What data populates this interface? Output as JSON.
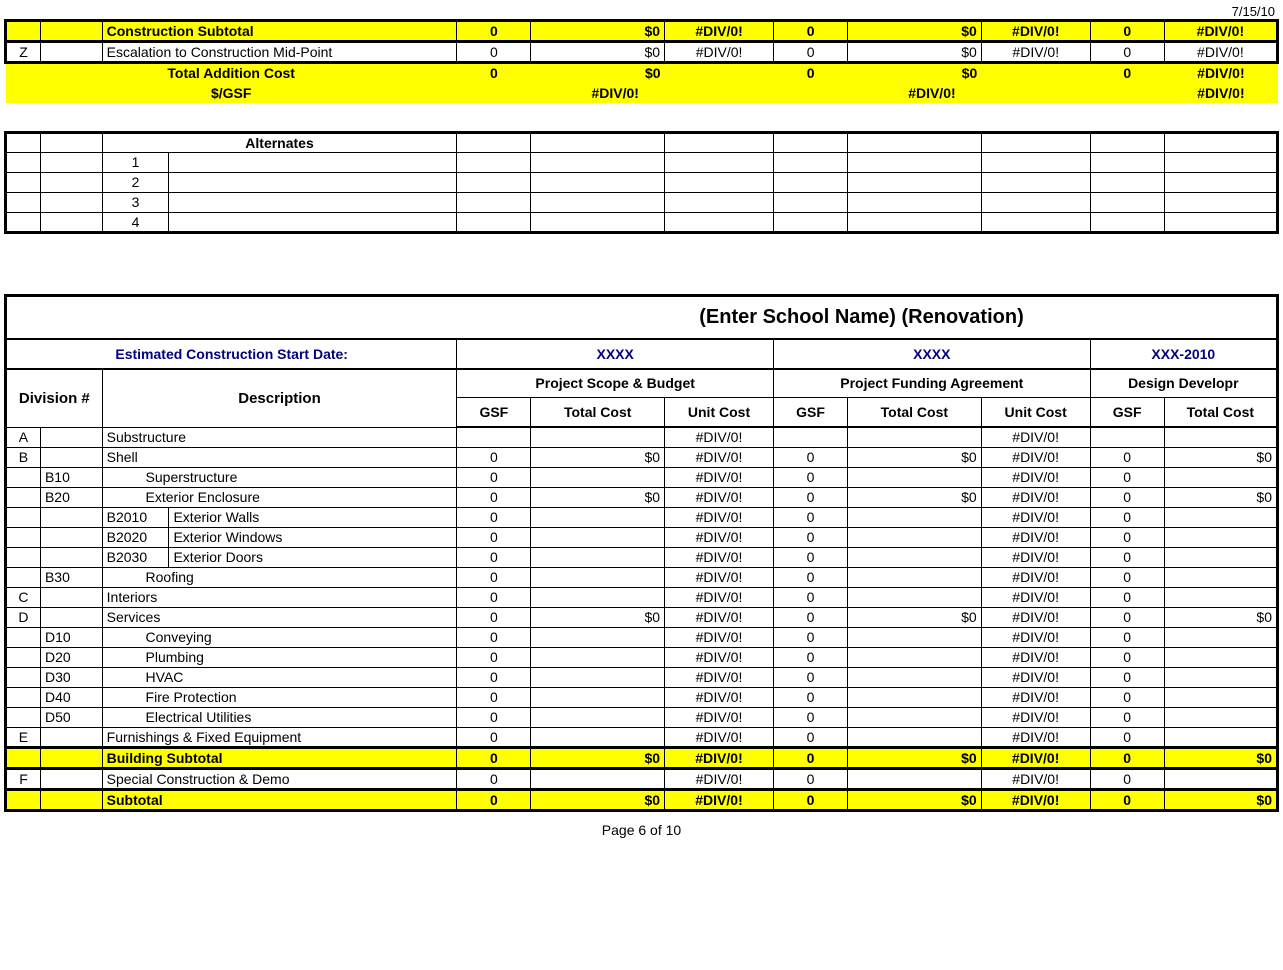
{
  "header_date": "7/15/10",
  "top": {
    "construction_subtotal": "Construction Subtotal",
    "escalation_row_label": "Escalation to Construction Mid-Point",
    "escalation_code": "Z",
    "total_addition_cost": "Total Addition Cost",
    "per_gsf": "$/GSF",
    "vals": {
      "zero": "0",
      "dollar0": "$0",
      "div0": "#DIV/0!"
    }
  },
  "alternates": {
    "header": "Alternates",
    "rows": [
      "1",
      "2",
      "3",
      "4"
    ]
  },
  "section2": {
    "title": "(Enter School Name) (Renovation)",
    "est_start": "Estimated Construction Start Date:",
    "xxxx": "XXXX",
    "xxx2010": "XXX-2010",
    "psb": "Project Scope & Budget",
    "pfa": "Project Funding Agreement",
    "dd": "Design Developr",
    "division": "Division #",
    "description": "Description",
    "gsf": "GSF",
    "total_cost": "Total Cost",
    "unit_cost": "Unit Cost"
  },
  "rows": [
    {
      "a": "A",
      "b": "",
      "c": "",
      "desc": "Substructure",
      "gsf1": "",
      "tc1": "",
      "uc1": "#DIV/0!",
      "gsf2": "",
      "tc2": "",
      "uc2": "#DIV/0!",
      "gsf3": "",
      "tc3": ""
    },
    {
      "a": "B",
      "b": "",
      "c": "",
      "desc": "Shell",
      "gsf1": "0",
      "tc1": "$0",
      "uc1": "#DIV/0!",
      "gsf2": "0",
      "tc2": "$0",
      "uc2": "#DIV/0!",
      "gsf3": "0",
      "tc3": "$0"
    },
    {
      "a": "",
      "b": "B10",
      "c": "",
      "desc": "Superstructure",
      "gsf1": "0",
      "tc1": "",
      "uc1": "#DIV/0!",
      "gsf2": "0",
      "tc2": "",
      "uc2": "#DIV/0!",
      "gsf3": "0",
      "tc3": "",
      "indent": 1
    },
    {
      "a": "",
      "b": "B20",
      "c": "",
      "desc": "Exterior Enclosure",
      "gsf1": "0",
      "tc1": "$0",
      "uc1": "#DIV/0!",
      "gsf2": "0",
      "tc2": "$0",
      "uc2": "#DIV/0!",
      "gsf3": "0",
      "tc3": "$0",
      "indent": 1
    },
    {
      "a": "",
      "b": "",
      "c": "B2010",
      "desc": "Exterior Walls",
      "gsf1": "0",
      "tc1": "",
      "uc1": "#DIV/0!",
      "gsf2": "0",
      "tc2": "",
      "uc2": "#DIV/0!",
      "gsf3": "0",
      "tc3": "",
      "indent": 0
    },
    {
      "a": "",
      "b": "",
      "c": "B2020",
      "desc": "Exterior Windows",
      "gsf1": "0",
      "tc1": "",
      "uc1": "#DIV/0!",
      "gsf2": "0",
      "tc2": "",
      "uc2": "#DIV/0!",
      "gsf3": "0",
      "tc3": "",
      "indent": 0
    },
    {
      "a": "",
      "b": "",
      "c": "B2030",
      "desc": "Exterior Doors",
      "gsf1": "0",
      "tc1": "",
      "uc1": "#DIV/0!",
      "gsf2": "0",
      "tc2": "",
      "uc2": "#DIV/0!",
      "gsf3": "0",
      "tc3": "",
      "indent": 0
    },
    {
      "a": "",
      "b": "B30",
      "c": "",
      "desc": "Roofing",
      "gsf1": "0",
      "tc1": "",
      "uc1": "#DIV/0!",
      "gsf2": "0",
      "tc2": "",
      "uc2": "#DIV/0!",
      "gsf3": "0",
      "tc3": "",
      "indent": 1
    },
    {
      "a": "C",
      "b": "",
      "c": "",
      "desc": "Interiors",
      "gsf1": "0",
      "tc1": "",
      "uc1": "#DIV/0!",
      "gsf2": "0",
      "tc2": "",
      "uc2": "#DIV/0!",
      "gsf3": "0",
      "tc3": ""
    },
    {
      "a": "D",
      "b": "",
      "c": "",
      "desc": "Services",
      "gsf1": "0",
      "tc1": "$0",
      "uc1": "#DIV/0!",
      "gsf2": "0",
      "tc2": "$0",
      "uc2": "#DIV/0!",
      "gsf3": "0",
      "tc3": "$0"
    },
    {
      "a": "",
      "b": "D10",
      "c": "",
      "desc": "Conveying",
      "gsf1": "0",
      "tc1": "",
      "uc1": "#DIV/0!",
      "gsf2": "0",
      "tc2": "",
      "uc2": "#DIV/0!",
      "gsf3": "0",
      "tc3": "",
      "indent": 1
    },
    {
      "a": "",
      "b": "D20",
      "c": "",
      "desc": "Plumbing",
      "gsf1": "0",
      "tc1": "",
      "uc1": "#DIV/0!",
      "gsf2": "0",
      "tc2": "",
      "uc2": "#DIV/0!",
      "gsf3": "0",
      "tc3": "",
      "indent": 1
    },
    {
      "a": "",
      "b": "D30",
      "c": "",
      "desc": "HVAC",
      "gsf1": "0",
      "tc1": "",
      "uc1": "#DIV/0!",
      "gsf2": "0",
      "tc2": "",
      "uc2": "#DIV/0!",
      "gsf3": "0",
      "tc3": "",
      "indent": 1
    },
    {
      "a": "",
      "b": "D40",
      "c": "",
      "desc": "Fire Protection",
      "gsf1": "0",
      "tc1": "",
      "uc1": "#DIV/0!",
      "gsf2": "0",
      "tc2": "",
      "uc2": "#DIV/0!",
      "gsf3": "0",
      "tc3": "",
      "indent": 1
    },
    {
      "a": "",
      "b": "D50",
      "c": "",
      "desc": "Electrical Utilities",
      "gsf1": "0",
      "tc1": "",
      "uc1": "#DIV/0!",
      "gsf2": "0",
      "tc2": "",
      "uc2": "#DIV/0!",
      "gsf3": "0",
      "tc3": "",
      "indent": 1
    },
    {
      "a": "E",
      "b": "",
      "c": "",
      "desc": "Furnishings & Fixed Equipment",
      "gsf1": "0",
      "tc1": "",
      "uc1": "#DIV/0!",
      "gsf2": "0",
      "tc2": "",
      "uc2": "#DIV/0!",
      "gsf3": "0",
      "tc3": ""
    }
  ],
  "building_subtotal": {
    "label": "Building Subtotal",
    "gsf1": "0",
    "tc1": "$0",
    "uc1": "#DIV/0!",
    "gsf2": "0",
    "tc2": "$0",
    "uc2": "#DIV/0!",
    "gsf3": "0",
    "tc3": "$0"
  },
  "row_f": {
    "a": "F",
    "desc": "Special Construction & Demo",
    "gsf1": "0",
    "tc1": "",
    "uc1": "#DIV/0!",
    "gsf2": "0",
    "tc2": "",
    "uc2": "#DIV/0!",
    "gsf3": "0",
    "tc3": ""
  },
  "subtotal": {
    "label": "Subtotal",
    "gsf1": "0",
    "tc1": "$0",
    "uc1": "#DIV/0!",
    "gsf2": "0",
    "tc2": "$0",
    "uc2": "#DIV/0!",
    "gsf3": "0",
    "tc3": "$0"
  },
  "footer": "Page 6 of 10"
}
